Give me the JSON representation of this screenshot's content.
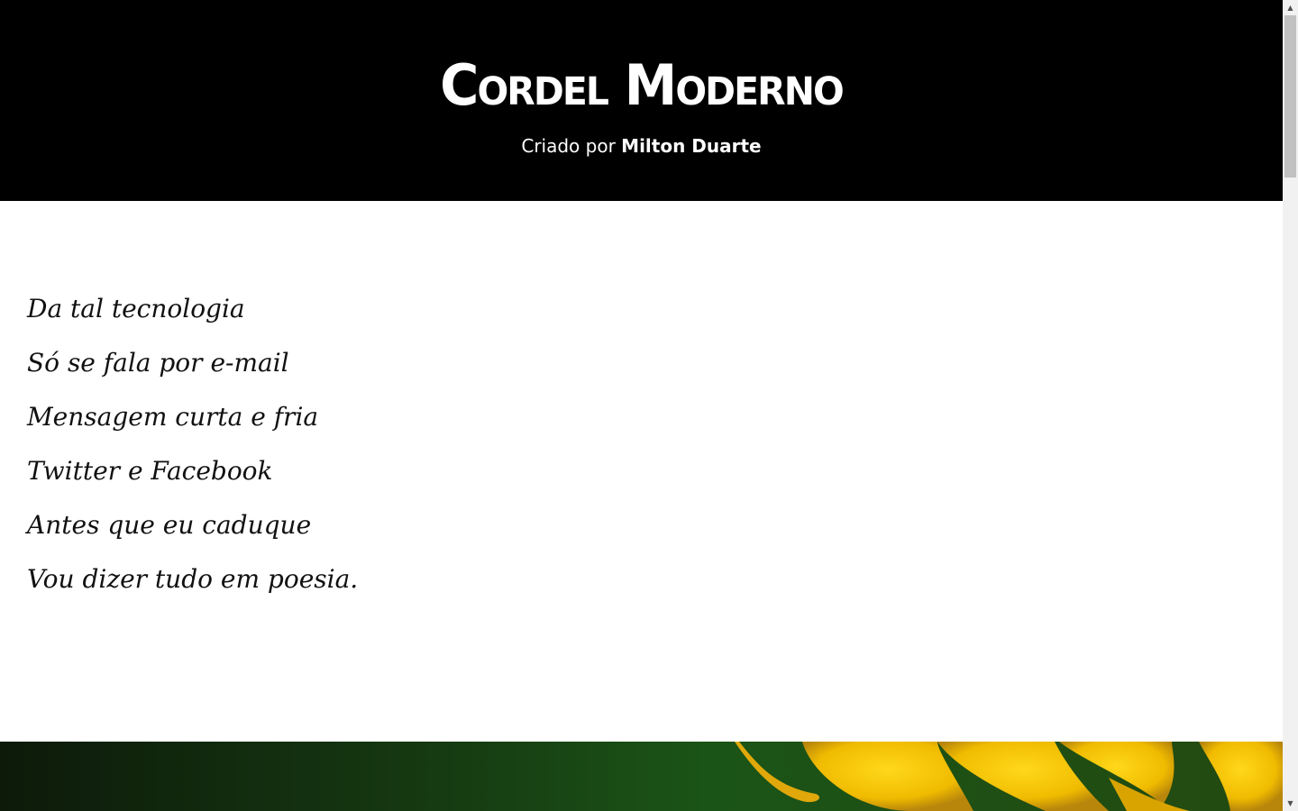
{
  "header": {
    "title": "Cordel Moderno",
    "byline_prefix": "Criado por",
    "byline_author": "Milton Duarte"
  },
  "poem": {
    "lines": [
      "Da tal tecnologia",
      "Só se fala por e-mail",
      "Mensagem curta e fria",
      "Twitter e Facebook",
      "Antes que eu caduque",
      "Vou dizer tudo em poesia."
    ]
  },
  "scrollbar": {
    "up_glyph": "▲",
    "down_glyph": "▼"
  },
  "colors": {
    "header_bg": "#000000",
    "header_text": "#ffffff",
    "body_bg": "#ffffff",
    "poem_text": "#111111",
    "flower_yellow": "#f2c200",
    "foliage_green": "#1b5417"
  },
  "icons": {
    "scroll_up": "arrow-up-icon",
    "scroll_down": "arrow-down-icon"
  }
}
